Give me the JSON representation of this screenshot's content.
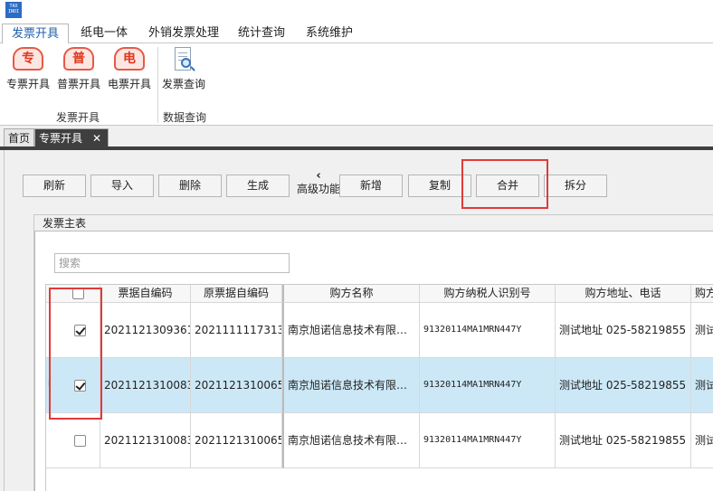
{
  "app": {
    "logo_text": "TAX INOI"
  },
  "menu": {
    "tabs": [
      {
        "label": "发票开具"
      },
      {
        "label": "纸电一体"
      },
      {
        "label": "外销发票处理"
      },
      {
        "label": "统计查询"
      },
      {
        "label": "系统维护"
      }
    ]
  },
  "ribbon": {
    "buttons": [
      {
        "glyph": "专",
        "label": "专票开具"
      },
      {
        "glyph": "普",
        "label": "普票开具"
      },
      {
        "glyph": "电",
        "label": "电票开具"
      }
    ],
    "group_issue_label": "发票开具",
    "query_button_label": "发票查询",
    "group_query_label": "数据查询"
  },
  "doc_tabs": {
    "home": "首页",
    "current": "专票开具",
    "close_glyph": "✕"
  },
  "toolbar": {
    "refresh": "刷新",
    "import": "导入",
    "delete": "删除",
    "generate": "生成",
    "advanced": "高级功能",
    "advanced_chevron": "‹",
    "add": "新增",
    "copy": "复制",
    "merge": "合并",
    "split": "拆分"
  },
  "panel": {
    "title": "发票主表"
  },
  "search": {
    "placeholder": "搜索"
  },
  "table": {
    "columns": [
      "票据自编码",
      "原票据自编码",
      "购方名称",
      "购方纳税人识别号",
      "购方地址、电话",
      "购方"
    ],
    "rows": [
      {
        "checked": true,
        "selected": false,
        "code": "2021121309361…",
        "orig_code": "2021111117313…",
        "buyer": "南京旭诺信息技术有限…",
        "tax_id": "91320114MA1MRN447Y",
        "address": "测试地址 025-58219855",
        "extra": "测试"
      },
      {
        "checked": true,
        "selected": true,
        "code": "2021121310083…",
        "orig_code": "2021121310065…",
        "buyer": "南京旭诺信息技术有限…",
        "tax_id": "91320114MA1MRN447Y",
        "address": "测试地址 025-58219855",
        "extra": "测试"
      },
      {
        "checked": false,
        "selected": false,
        "code": "2021121310083…",
        "orig_code": "2021121310065…",
        "buyer": "南京旭诺信息技术有限…",
        "tax_id": "91320114MA1MRN447Y",
        "address": "测试地址 025-58219855",
        "extra": "测试"
      }
    ]
  },
  "colors": {
    "accent": "#1f5fae",
    "highlight_box": "#e03a3a",
    "selected_row": "#cce8f7",
    "active_tab": "#3f3f3f"
  }
}
